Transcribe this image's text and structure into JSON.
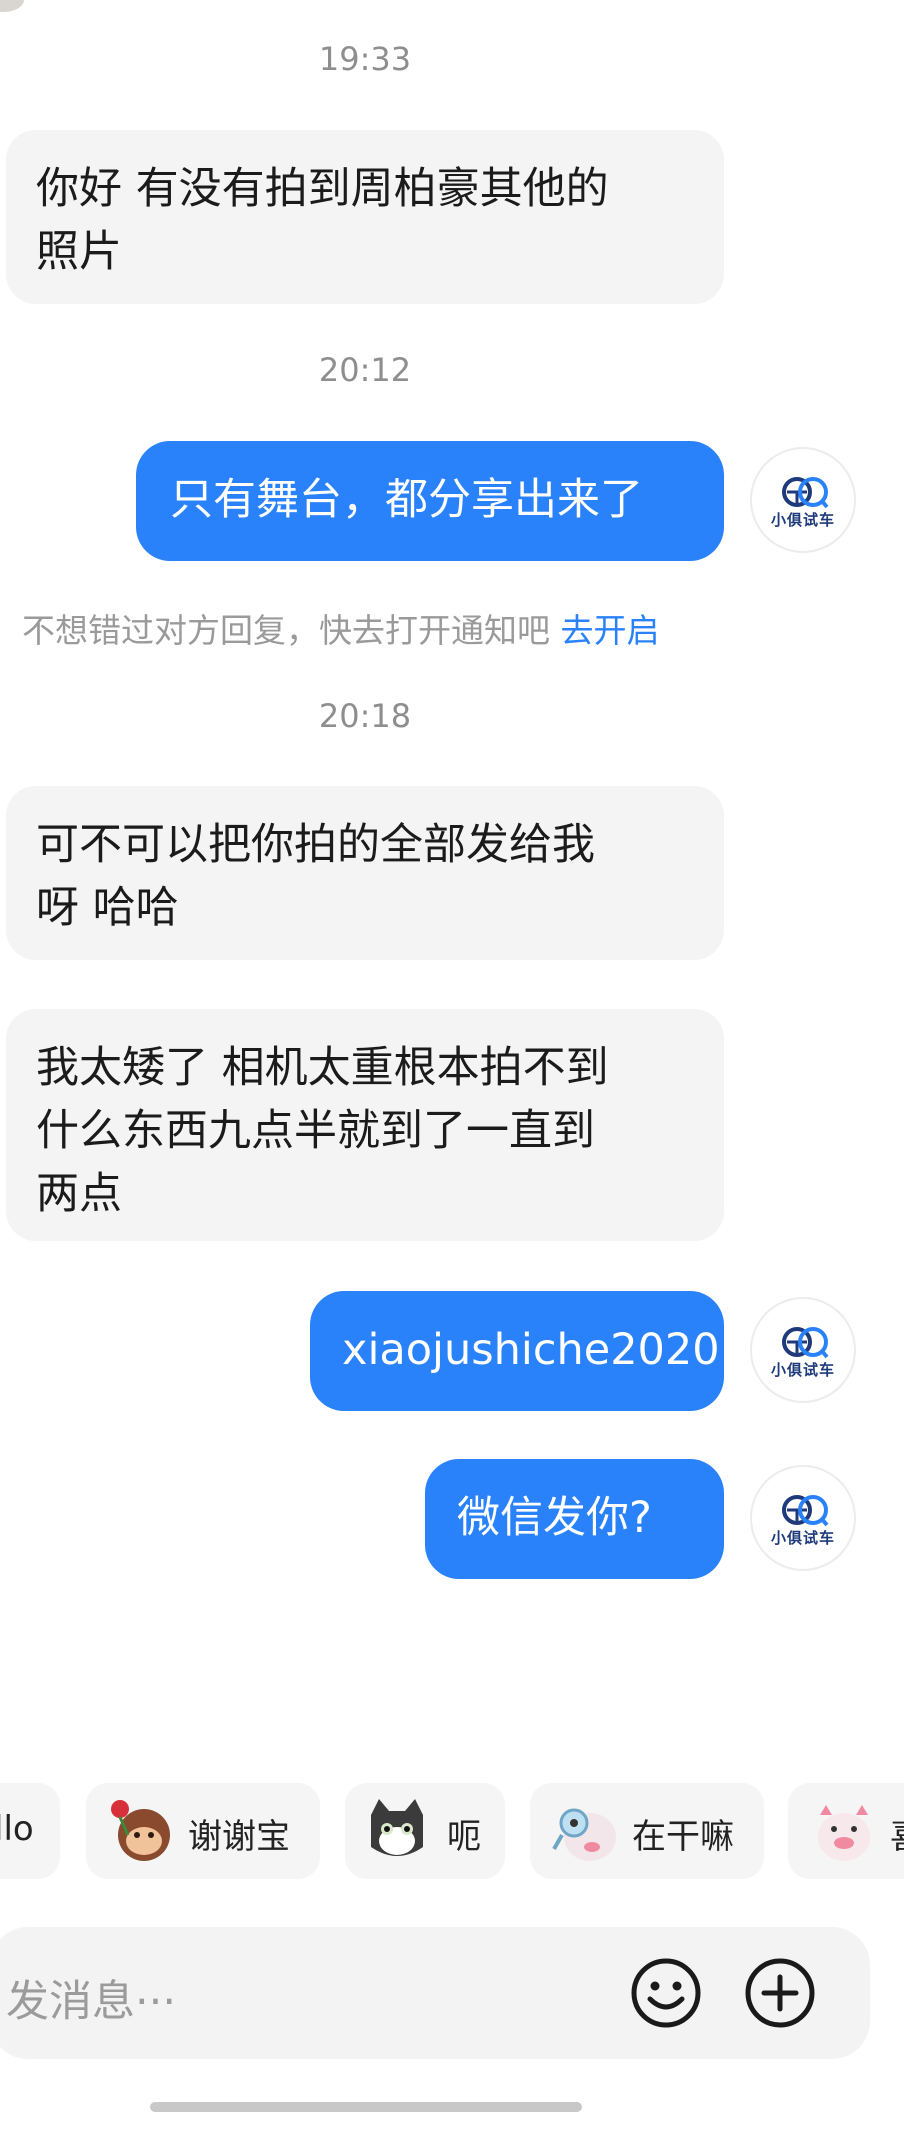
{
  "messages": {
    "t1": "19:33",
    "m1_line1": "你好 有没有拍到周柏豪其他的",
    "m1_line2": "照片",
    "t2": "20:12",
    "m2": "只有舞台，都分享出来了",
    "notice_text": "不想错过对方回复，快去打开通知吧",
    "notice_link": "去开启",
    "t3": "20:18",
    "m3_line1": "可不可以把你拍的全部发给我",
    "m3_line2": "呀 哈哈",
    "m4_line1": "我太矮了 相机太重根本拍不到",
    "m4_line2": "什么东西九点半就到了一直到",
    "m4_line3": "两点",
    "m5": "xiaojushiche2020",
    "m6": "微信发你?"
  },
  "avatar": {
    "label": "小俱试车",
    "brand_color": "#1e3a7a",
    "accent_color": "#2a82fb"
  },
  "quick_replies": [
    {
      "label": "llo",
      "icon": "none"
    },
    {
      "label": "谢谢宝",
      "icon": "monkey-rose-sticker"
    },
    {
      "label": "呃",
      "icon": "cat-sticker"
    },
    {
      "label": "在干嘛",
      "icon": "pig-magnifier-sticker"
    },
    {
      "label": "喜",
      "icon": "pig-sticker"
    }
  ],
  "input": {
    "placeholder": "发消息···"
  },
  "icons": {
    "emoji": "smiley-icon",
    "plus": "plus-circle-icon"
  },
  "colors": {
    "outgoing_bubble": "#2a82fb",
    "incoming_bubble": "#f4f4f4",
    "link": "#2a82fb"
  }
}
